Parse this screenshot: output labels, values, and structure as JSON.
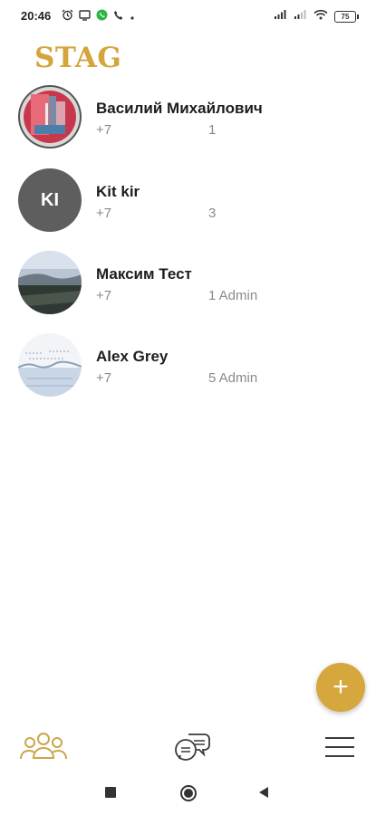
{
  "status_bar": {
    "time": "20:46",
    "battery": "75",
    "icons": [
      "alarm-icon",
      "screen-cast-icon",
      "whatsapp-icon",
      "phone-icon",
      "signal-icon",
      "signal-icon",
      "wifi-icon",
      "battery-icon"
    ]
  },
  "app": {
    "title": "STAG",
    "accent_color": "#d6a73d"
  },
  "contacts": [
    {
      "name": "Василий Михайлович",
      "phone": "+7",
      "meta": "1",
      "avatar_type": "photo"
    },
    {
      "name": "Kit kir",
      "phone": "+7",
      "meta": "3",
      "avatar_type": "initials",
      "initials": "KI"
    },
    {
      "name": "Максим Тест",
      "phone": "+7",
      "meta": "1 Admin",
      "avatar_type": "photo"
    },
    {
      "name": "Alex Grey",
      "phone": "+7",
      "meta": "5 Admin",
      "avatar_type": "photo"
    }
  ],
  "fab": {
    "label": "+"
  },
  "bottom_nav": {
    "items": [
      "contacts-icon",
      "chats-icon",
      "menu-icon"
    ],
    "active": "contacts-icon"
  },
  "system_nav": {
    "items": [
      "recent-apps-icon",
      "home-icon",
      "back-icon"
    ]
  }
}
